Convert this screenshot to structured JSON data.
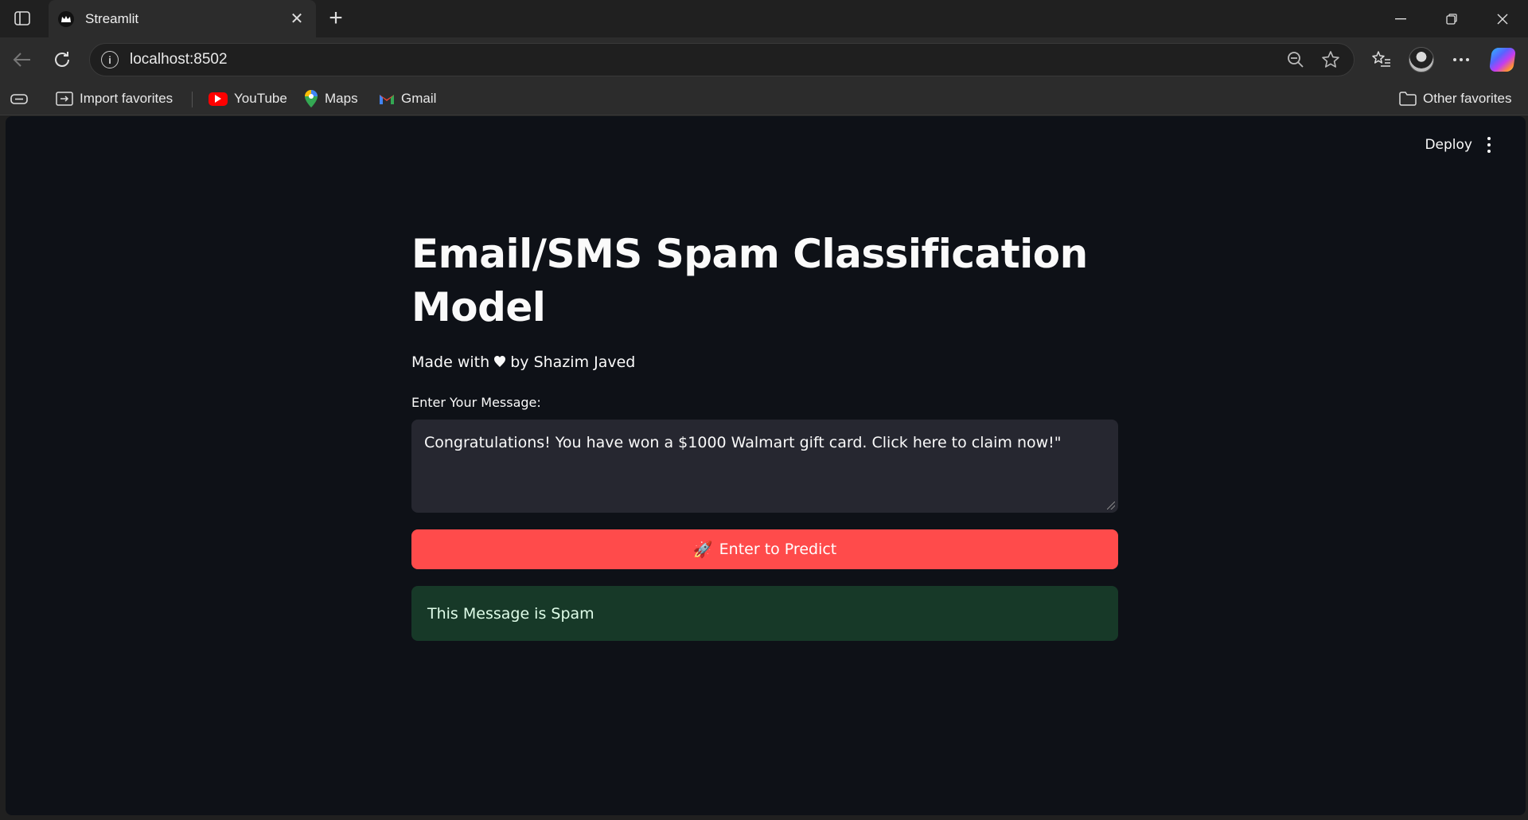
{
  "browser": {
    "tab": {
      "title": "Streamlit",
      "favicon": "streamlit-crown-icon"
    },
    "address": {
      "url": "localhost:8502"
    },
    "favorites": {
      "import": "Import favorites",
      "items": [
        {
          "label": "YouTube",
          "icon": "youtube-icon"
        },
        {
          "label": "Maps",
          "icon": "maps-pin-icon"
        },
        {
          "label": "Gmail",
          "icon": "gmail-icon"
        }
      ],
      "other": "Other favorites"
    }
  },
  "app": {
    "header": {
      "deploy_label": "Deploy"
    },
    "title": "Email/SMS Spam Classification Model",
    "credit_prefix": "Made with",
    "credit_suffix": "by Shazim Javed",
    "input": {
      "label": "Enter Your Message:",
      "value": "Congratulations! You have won a $1000 Walmart gift card. Click here to claim now!\""
    },
    "button": {
      "icon": "🚀",
      "label": "Enter to Predict"
    },
    "result": {
      "text": "This Message is Spam"
    },
    "colors": {
      "accent": "#ff4b4b",
      "success_bg": "#173928",
      "page_bg": "#0e1117"
    }
  }
}
